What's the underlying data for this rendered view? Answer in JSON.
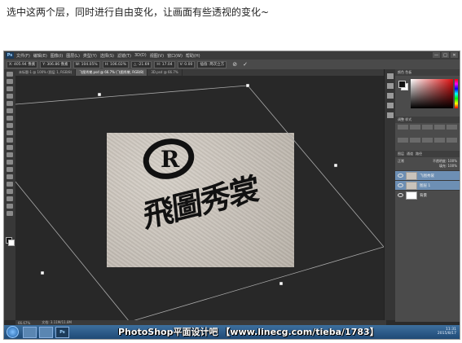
{
  "caption": "选中这两个层，同时进行自由变化，让画面有些透视的变化~",
  "app": {
    "logo": "Ps",
    "menu": [
      "文件(F)",
      "编辑(E)",
      "图像(I)",
      "图层(L)",
      "类型(Y)",
      "选择(S)",
      "滤镜(T)",
      "3D(D)",
      "视图(V)",
      "窗口(W)",
      "帮助(H)"
    ],
    "window_buttons": [
      "—",
      "□",
      "✕"
    ]
  },
  "options_bar": {
    "x": "X: 405.94 像素",
    "y": "Y: 306.86 像素",
    "w": "W: 104.05%",
    "h": "H: 106.02%",
    "angle": "△ -21.69",
    "skew_h": "H: 17.04",
    "skew_v": "V: 0.00",
    "interp": "插值: 两次立方",
    "commit": "✓",
    "cancel": "⊘"
  },
  "tabs": [
    {
      "label": "未标题-1 @ 100% (图层 1, RGB/8)",
      "active": false
    },
    {
      "label": "飞图秀裳.psd @ 66.7% (飞图秀裳, RGB/8)",
      "active": true
    },
    {
      "label": "3D.psd @ 66.7%",
      "active": false
    }
  ],
  "document": {
    "logo_text": "飛圖秀裳",
    "reg_mark": "R"
  },
  "status_bar": {
    "zoom": "66.67%",
    "doc_info": "文档: 3.11M/11.8M"
  },
  "panels": {
    "color_tabs": "颜色  色板",
    "adjust_title": "调整  样式",
    "layers_tabs": [
      "图层",
      "通道",
      "路径"
    ],
    "blend_mode": "正常",
    "opacity": "不透明度: 100%",
    "fill": "填充: 100%",
    "layers": [
      {
        "name": "飞图秀裳",
        "selected": true,
        "white_thumb": false
      },
      {
        "name": "图层 1",
        "selected": true,
        "white_thumb": false
      },
      {
        "name": "背景",
        "selected": false,
        "white_thumb": true
      }
    ]
  },
  "taskbar": {
    "watermark": "PhotoShop平面设计吧 【www.linecg.com/tieba/1783】",
    "time": "11:31",
    "date": "2015/8/17"
  },
  "colors": {
    "workspace": "#282828",
    "panel": "#4b4b4b",
    "selection": "#6d8fb4",
    "paper": "#c9c3bb"
  }
}
